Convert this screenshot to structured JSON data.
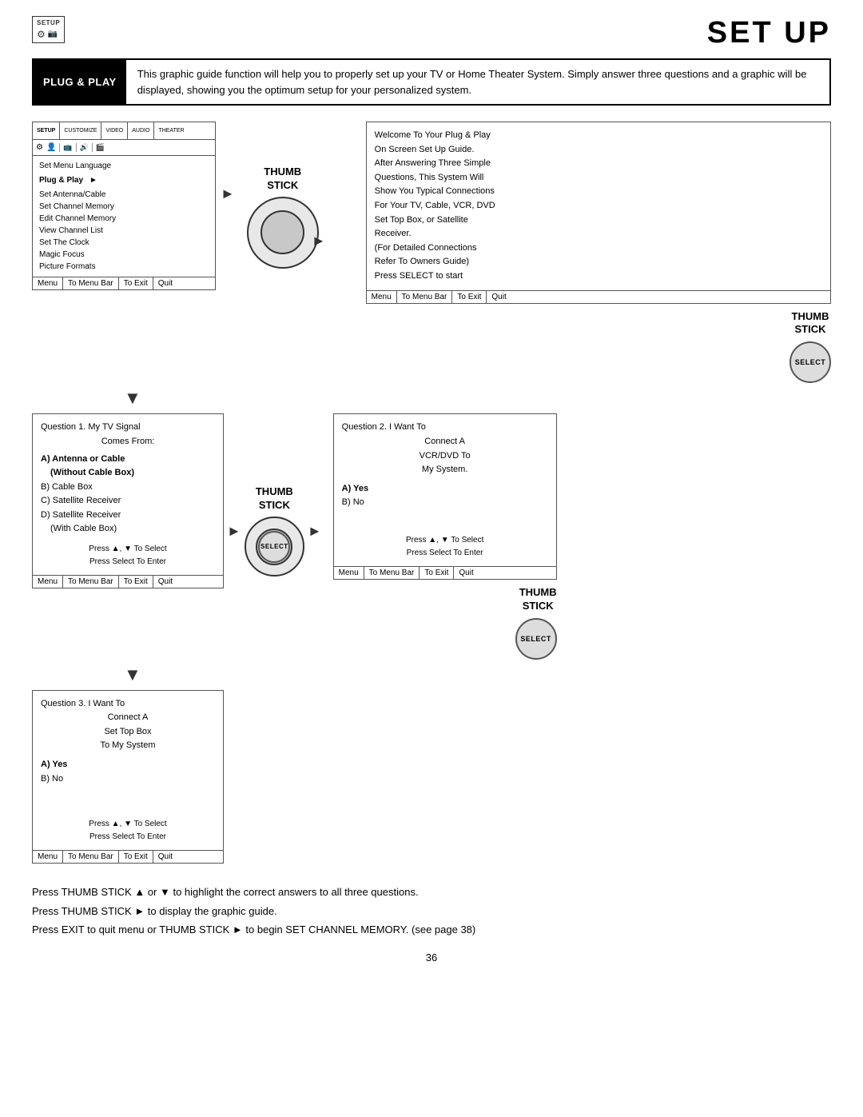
{
  "header": {
    "setup_icon_text": "SETUP",
    "page_title": "SET UP"
  },
  "intro": {
    "label": "PLUG & PLAY",
    "text": "This graphic guide function will help you to properly set up your TV or Home Theater System.  Simply answer three questions and a graphic will be displayed, showing you the optimum setup for your personalized system."
  },
  "screen1": {
    "tabs": [
      "SETUP",
      "CUSTOMIZE",
      "VIDEO",
      "AUDIO",
      "THEATER"
    ],
    "menu_items": [
      {
        "text": "Set Menu Language",
        "active": false
      },
      {
        "text": "Plug & Play",
        "active": true,
        "arrow": true
      },
      {
        "text": "Set Antenna/Cable",
        "active": false
      },
      {
        "text": "Set Channel Memory",
        "active": false
      },
      {
        "text": "Edit Channel Memory",
        "active": false
      },
      {
        "text": "View Channel List",
        "active": false
      },
      {
        "text": "Set The Clock",
        "active": false
      },
      {
        "text": "Magic Focus",
        "active": false
      },
      {
        "text": "Picture Formats",
        "active": false
      }
    ],
    "footer": [
      "Menu",
      "To Menu Bar",
      "To Exit",
      "Quit"
    ]
  },
  "welcome_box": {
    "lines": [
      "Welcome To Your Plug & Play",
      "On Screen Set Up Guide.",
      "After Answering Three Simple",
      "Questions, This System Will",
      "Show You Typical Connections",
      "For Your TV, Cable, VCR, DVD",
      "Set Top Box, or Satellite",
      "Receiver.",
      "(For Detailed Connections",
      "Refer To Owners Guide)",
      "Press SELECT to start"
    ],
    "footer": [
      "Menu",
      "To Menu Bar",
      "To Exit",
      "Quit"
    ]
  },
  "thumb_stick": {
    "label1": "THUMB",
    "label2": "STICK"
  },
  "thumb_stick2": {
    "label1": "THUMB",
    "label2": "STICK"
  },
  "thumb_stick3": {
    "label1": "THUMB",
    "label2": "STICK"
  },
  "thumb_stick4": {
    "label1": "THUMB",
    "label2": "STICK"
  },
  "select_btn": "SELECT",
  "question1": {
    "title": "Question 1.  My TV Signal",
    "subtitle": "Comes From:",
    "items": [
      {
        "text": "A) Antenna or Cable",
        "bold": true
      },
      {
        "text": "(Without Cable Box)",
        "bold": true,
        "indent": true
      },
      {
        "text": "B) Cable Box",
        "bold": false
      },
      {
        "text": "C) Satellite Receiver",
        "bold": false
      },
      {
        "text": "D) Satellite Receiver",
        "bold": false
      },
      {
        "text": "(With Cable Box)",
        "bold": false,
        "indent": true
      }
    ],
    "instructions": [
      "Press ▲, ▼ To Select",
      "Press Select To Enter"
    ],
    "footer": [
      "Menu",
      "To Menu Bar",
      "To Exit",
      "Quit"
    ]
  },
  "question2": {
    "title": "Question 2.   I Want To",
    "subtitle": "Connect A",
    "subtitle2": "VCR/DVD To",
    "subtitle3": "My System.",
    "items": [
      {
        "text": "A) Yes",
        "bold": true
      },
      {
        "text": "B) No",
        "bold": false
      }
    ],
    "instructions": [
      "Press ▲, ▼ To Select",
      "Press Select To Enter"
    ],
    "footer": [
      "Menu",
      "To Menu Bar",
      "To Exit",
      "Quit"
    ]
  },
  "question3": {
    "title": "Question 3.   I Want To",
    "subtitle": "Connect A",
    "subtitle2": "Set Top Box",
    "subtitle3": "To My System",
    "items": [
      {
        "text": "A) Yes",
        "bold": true
      },
      {
        "text": "B) No",
        "bold": false
      }
    ],
    "instructions": [
      "Press ▲, ▼ To Select",
      "Press Select To Enter"
    ],
    "footer": [
      "Menu",
      "To Menu Bar",
      "To Exit",
      "Quit"
    ]
  },
  "bottom_text": {
    "line1": "Press  THUMB STICK ▲ or ▼ to highlight the correct answers to all three questions.",
    "line2": "Press THUMB STICK ► to display the graphic guide.",
    "line3": "Press EXIT to quit menu or THUMB STICK ► to begin SET CHANNEL MEMORY. (see page 38)"
  },
  "page_number": "36"
}
